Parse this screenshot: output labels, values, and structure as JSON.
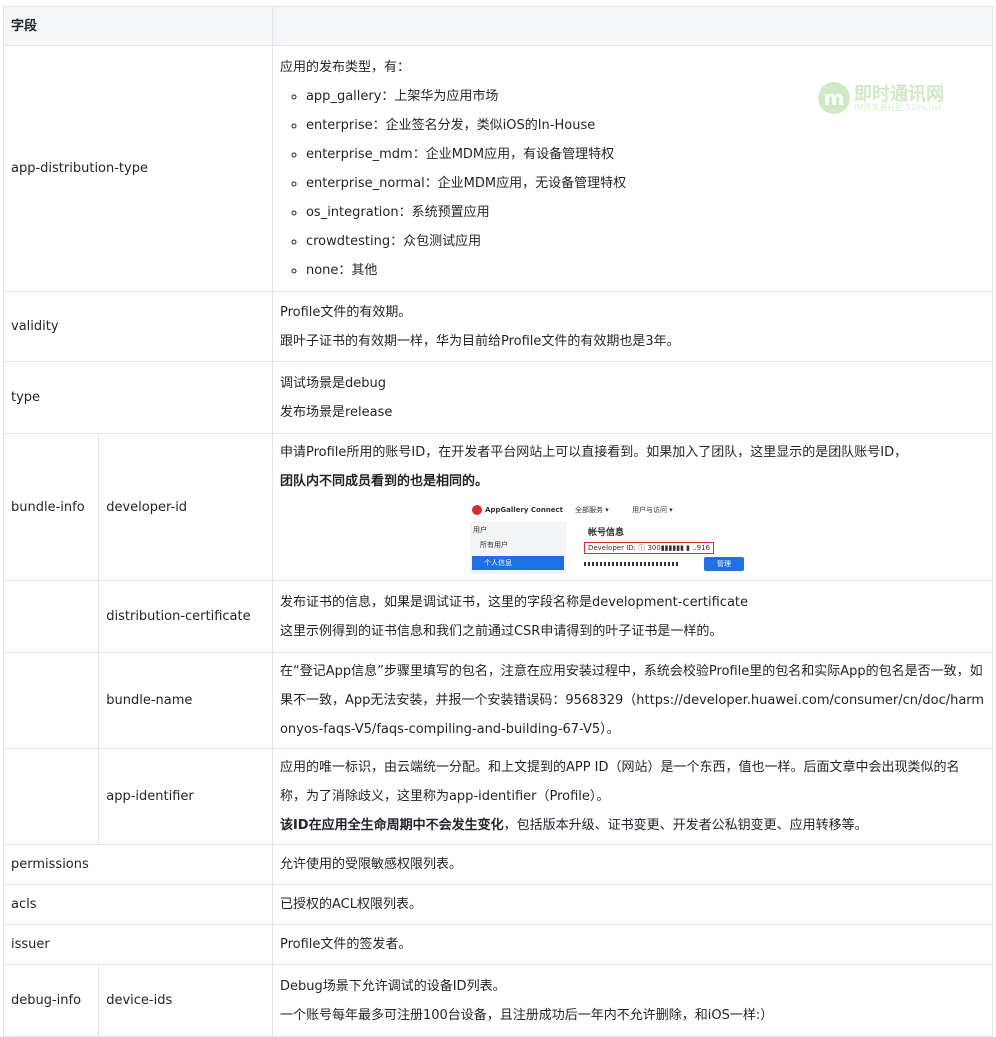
{
  "header": {
    "field": "字段",
    "desc": ""
  },
  "rows": {
    "adt": {
      "name": "app-distribution-type",
      "intro": "应用的发布类型，有：",
      "items": [
        "app_gallery：上架华为应用市场",
        "enterprise：企业签名分发，类似iOS的In-House",
        "enterprise_mdm：企业MDM应用，有设备管理特权",
        "enterprise_normal：企业MDM应用，无设备管理特权",
        "os_integration：系统预置应用",
        "crowdtesting：众包测试应用",
        "none：其他"
      ]
    },
    "validity": {
      "name": "validity",
      "p1": "Profile文件的有效期。",
      "p2": "跟叶子证书的有效期一样，华为目前给Profile文件的有效期也是3年。"
    },
    "type": {
      "name": "type",
      "p1": "调试场景是debug",
      "p2": "发布场景是release"
    },
    "bundle_info": {
      "name": "bundle-info"
    },
    "developer_id": {
      "name": "developer-id",
      "text": "申请Profile所用的账号ID，在开发者平台网站上可以直接看到。如果加入了团队，这里显示的是团队账号ID，",
      "bold": "团队内不同成员看到的也是相同的。"
    },
    "dist_cert": {
      "name": "distribution-certificate",
      "p1": "发布证书的信息，如果是调试证书，这里的字段名称是development-certificate",
      "p2": "这里示例得到的证书信息和我们之前通过CSR申请得到的叶子证书是一样的。"
    },
    "bundle_name": {
      "name": "bundle-name",
      "text": "在“登记App信息”步骤里填写的包名，注意在应用安装过程中，系统会校验Profile里的包名和实际App的包名是否一致，如果不一致，App无法安装，并报一个安装错误码：9568329（https://developer.huawei.com/consumer/cn/doc/harmonyos-faqs-V5/faqs-compiling-and-building-67-V5）。"
    },
    "app_identifier": {
      "name": "app-identifier",
      "p1": "应用的唯一标识，由云端统一分配。和上文提到的APP ID（网站）是一个东西，值也一样。后面文章中会出现类似的名称，为了消除歧义，这里称为app-identifier（Profile）。",
      "bold": "该ID在应用全生命周期中不会发生变化",
      "rest": "，包括版本升级、证书变更、开发者公私钥变更、应用转移等。"
    },
    "permissions": {
      "name": "permissions",
      "desc": "允许使用的受限敏感权限列表。"
    },
    "acls": {
      "name": "acls",
      "desc": "已授权的ACL权限列表。"
    },
    "issuer": {
      "name": "issuer",
      "desc": "Profile文件的签发者。"
    },
    "debug_info": {
      "name": "debug-info",
      "sub": "device-ids",
      "p1": "Debug场景下允许调试的设备ID列表。",
      "p2": "一个账号每年最多可注册100台设备，且注册成功后一年内不允许删除，和iOS一样:）"
    }
  },
  "screenshot": {
    "brand": "AppGallery Connect",
    "menu1": "全部服务 ▾",
    "menu2": "用户与访问 ▾",
    "side_title": "用户",
    "side_all": "所有用户",
    "side_active": "个人信息",
    "acct_title": "帐号信息",
    "dev_label": "Developer ID: ⓘ  300▮▮▮▮▮▮ ▮  ..916",
    "manage": "管理"
  },
  "watermark": {
    "logo_letter": "m",
    "title": "即时通讯网",
    "subtitle": "IM开发者社区 52im.net"
  },
  "colors": {
    "border": "#e3e5e8",
    "header_bg": "#f5f6f7",
    "accent": "#1f6fe5",
    "highlight": "#d93025"
  }
}
